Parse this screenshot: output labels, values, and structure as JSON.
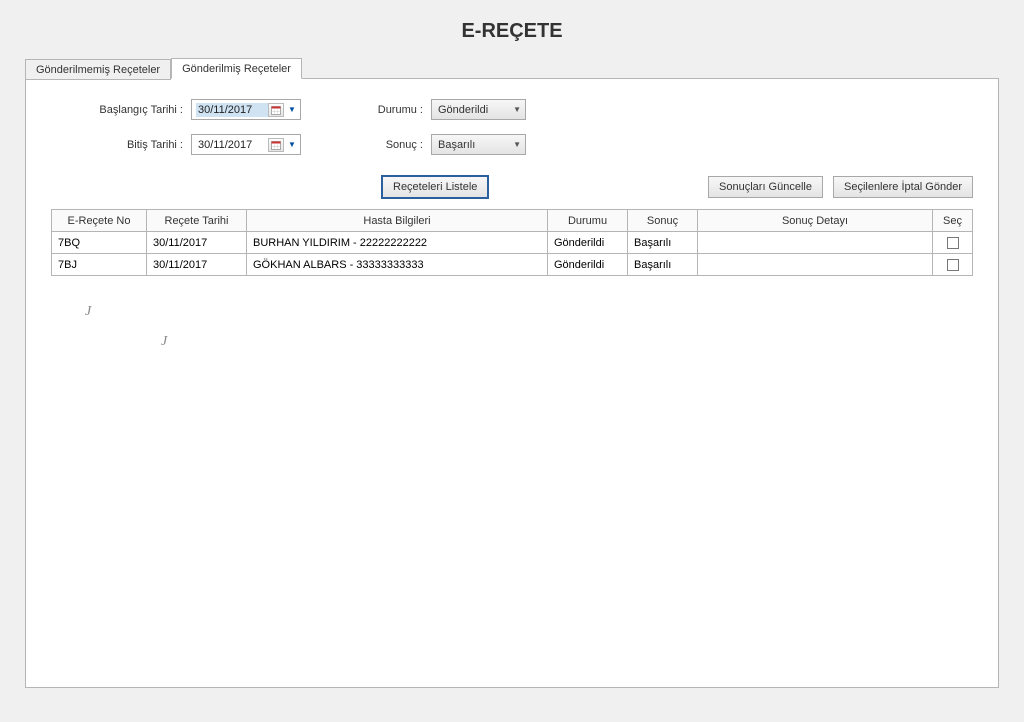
{
  "title": "E-REÇETE",
  "tabs": {
    "unsent": "Gönderilmemiş Reçeteler",
    "sent": "Gönderilmiş Reçeteler"
  },
  "filters": {
    "start_label": "Başlangıç Tarihi :",
    "start_value": "30/11/2017",
    "end_label": "Bitiş Tarihi :",
    "end_value": "30/11/2017",
    "status_label": "Durumu :",
    "status_value": "Gönderildi",
    "result_label": "Sonuç :",
    "result_value": "Başarılı"
  },
  "actions": {
    "list": "Reçeteleri Listele",
    "update": "Sonuçları Güncelle",
    "cancel": "Seçilenlere İptal Gönder"
  },
  "columns": {
    "no": "E-Reçete No",
    "date": "Reçete Tarihi",
    "patient": "Hasta Bilgileri",
    "status": "Durumu",
    "result": "Sonuç",
    "detail": "Sonuç Detayı",
    "select": "Seç"
  },
  "rows": [
    {
      "no": "7BQ",
      "date": "30/11/2017",
      "patient": "BURHAN YILDIRIM - 22222222222",
      "status": "Gönderildi",
      "result": "Başarılı",
      "detail": ""
    },
    {
      "no": "7BJ",
      "date": "30/11/2017",
      "patient": "GÖKHAN ALBARS - 33333333333",
      "status": "Gönderildi",
      "result": "Başarılı",
      "detail": ""
    }
  ]
}
